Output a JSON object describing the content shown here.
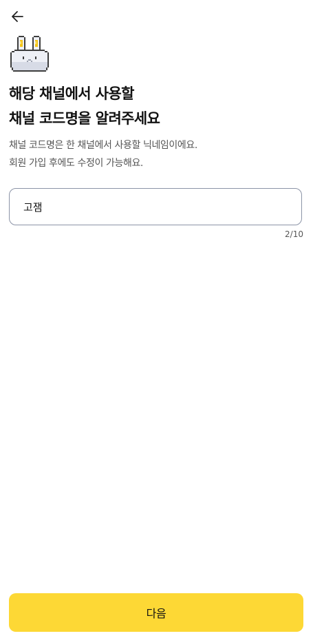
{
  "header": {
    "back_icon": "arrow-left-icon"
  },
  "mascot": {
    "icon": "pixel-rabbit-icon"
  },
  "title": {
    "line1": "해당 채널에서 사용할",
    "line2": "채널 코드명을 알려주세요"
  },
  "description": {
    "line1": "채널 코드명은 한 채널에서 사용할 닉네임이에요.",
    "line2": "회원 가입 후에도 수정이 가능해요."
  },
  "code_name_input": {
    "value": "고잼",
    "counter": "2/10"
  },
  "next_button": {
    "label": "다음"
  },
  "colors": {
    "accent": "#fdd835",
    "input_border": "#8b93a6"
  }
}
